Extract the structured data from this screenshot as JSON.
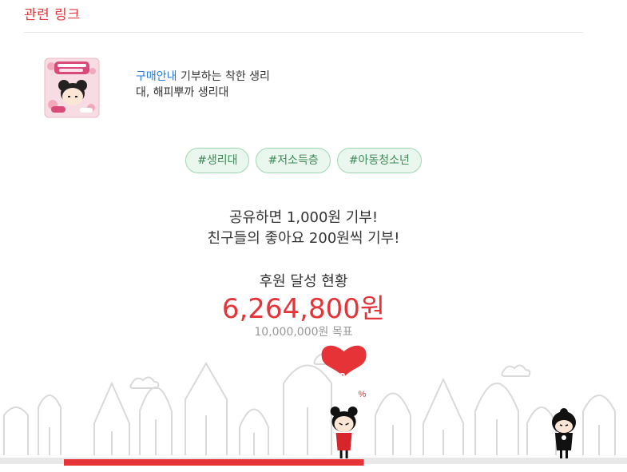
{
  "section": {
    "title": "관련 링크"
  },
  "product": {
    "image_icon": "sanitary-pad-package-icon",
    "link_label": "구매안내",
    "description_line1": " 기부하는 착한 생리",
    "description_line2": "대, 해피뿌까 생리대"
  },
  "tags": [
    "#생리대",
    "#저소득층",
    "#아동청소년"
  ],
  "share": {
    "line1": "공유하면 1,000원 기부!",
    "line2": "친구들의 좋아요 200원씩 기부!"
  },
  "donation": {
    "label": "후원 달성 현황",
    "amount": "6,264,800원",
    "goal": "10,000,000원 목표",
    "percent": "62.6",
    "percent_unit": "%",
    "progress": 0.626
  },
  "colors": {
    "accent": "#e63338",
    "tag_bg": "#eaf7ee",
    "tag_text": "#3f8a58",
    "link": "#2a7bd4"
  }
}
